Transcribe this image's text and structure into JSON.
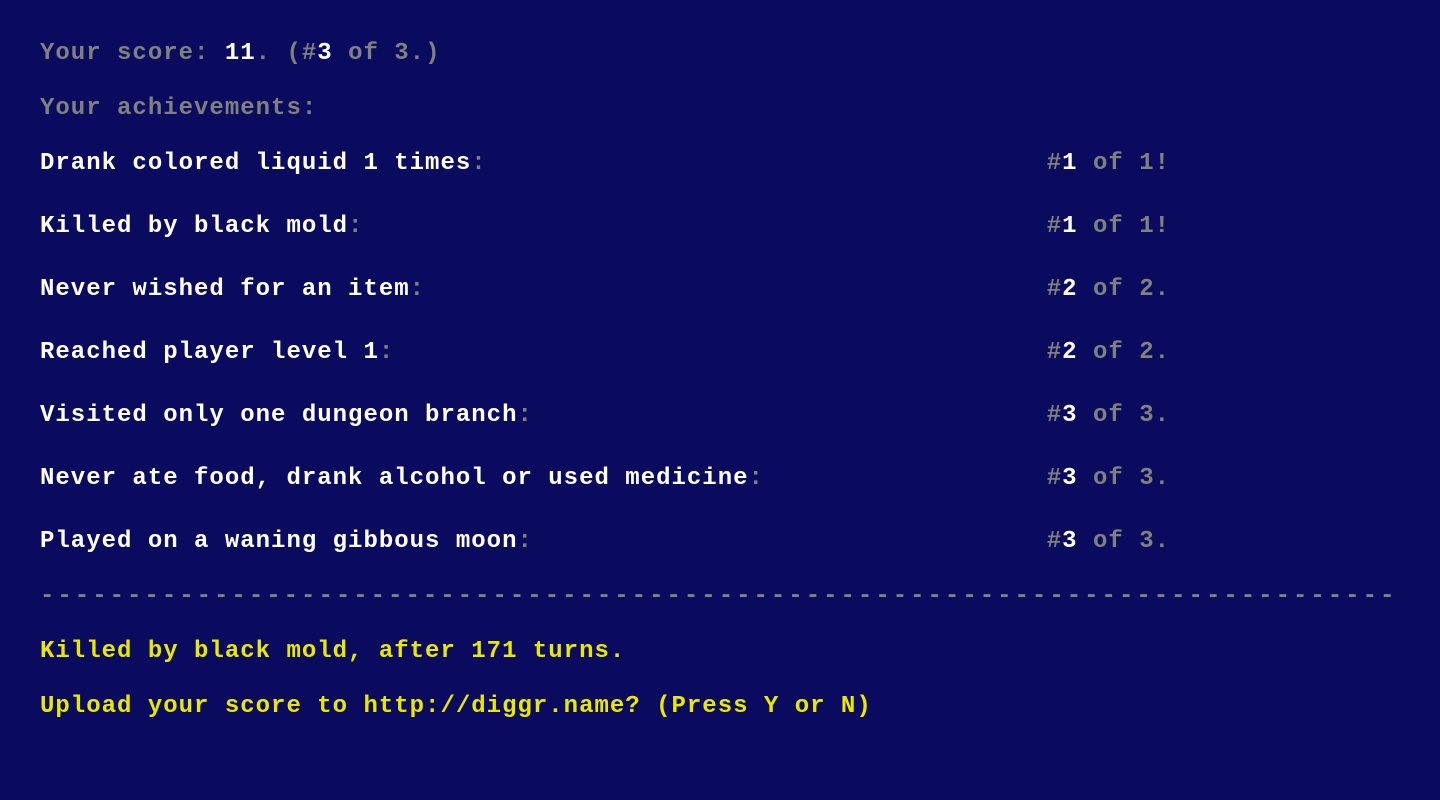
{
  "score": {
    "label_prefix": "Your score: ",
    "value": "11",
    "suffix_dot": ".",
    "rank_prefix": "    (#",
    "rank": "3",
    "rank_suffix": " of 3.)"
  },
  "achievements_header": "Your achievements:",
  "achievements": [
    {
      "text": "Drank colored liquid 1 times",
      "rank_num": "1",
      "rank_rest": " of 1!"
    },
    {
      "text": "Killed by black mold",
      "rank_num": "1",
      "rank_rest": " of 1!"
    },
    {
      "text": "Never wished for an item",
      "rank_num": "2",
      "rank_rest": " of 2."
    },
    {
      "text": "Reached player level 1",
      "rank_num": "2",
      "rank_rest": " of 2."
    },
    {
      "text": "Visited only one dungeon branch",
      "rank_num": "3",
      "rank_rest": " of 3."
    },
    {
      "text": "Never ate food, drank alcohol or used medicine",
      "rank_num": "3",
      "rank_rest": " of 3."
    },
    {
      "text": "Played on a waning gibbous moon",
      "rank_num": "3",
      "rank_rest": " of 3."
    }
  ],
  "divider": "------------------------------------------------------------------------------------------------",
  "death_message": "Killed by black mold, after 171 turns.",
  "upload_prompt": "Upload your score to http://diggr.name? (Press Y or N)"
}
